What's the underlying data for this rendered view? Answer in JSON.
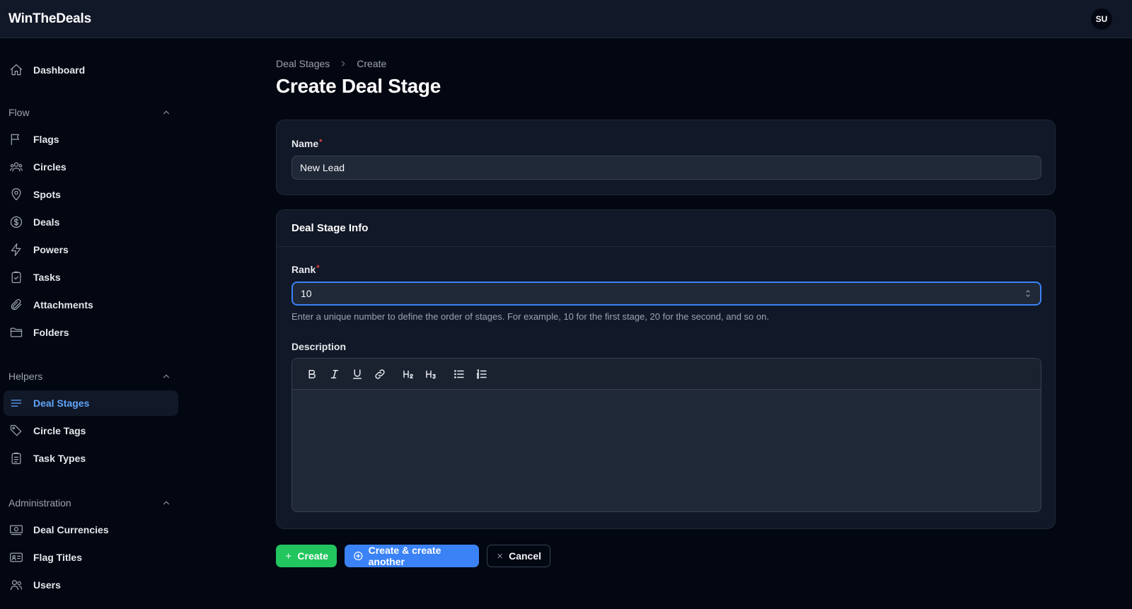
{
  "app": {
    "title": "WinTheDeals",
    "user_initials": "SU"
  },
  "sidebar": {
    "dashboard": "Dashboard",
    "groups": [
      {
        "label": "Flow",
        "items": [
          "Flags",
          "Circles",
          "Spots",
          "Deals",
          "Powers",
          "Tasks",
          "Attachments",
          "Folders"
        ]
      },
      {
        "label": "Helpers",
        "items": [
          "Deal Stages",
          "Circle Tags",
          "Task Types"
        ]
      },
      {
        "label": "Administration",
        "items": [
          "Deal Currencies",
          "Flag Titles",
          "Users"
        ]
      }
    ],
    "active_item": "Deal Stages"
  },
  "breadcrumb": [
    "Deal Stages",
    "Create"
  ],
  "page_title": "Create Deal Stage",
  "form": {
    "name": {
      "label": "Name",
      "required_mark": "*",
      "value": "New Lead"
    },
    "section_title": "Deal Stage Info",
    "rank": {
      "label": "Rank",
      "required_mark": "*",
      "value": "10",
      "helper": "Enter a unique number to define the order of stages. For example, 10 for the first stage, 20 for the second, and so on."
    },
    "description": {
      "label": "Description",
      "toolbar": [
        "bold-icon",
        "italic-icon",
        "underline-icon",
        "link-icon",
        "heading-2-icon",
        "heading-3-icon",
        "bullet-list-icon",
        "ordered-list-icon"
      ],
      "value": ""
    }
  },
  "actions": {
    "create": "Create",
    "create_another": "Create & create another",
    "cancel": "Cancel"
  },
  "colors": {
    "accent": "#3b82f6",
    "success": "#22c55e",
    "active_nav": "#60a5fa",
    "required": "#ef4444"
  }
}
